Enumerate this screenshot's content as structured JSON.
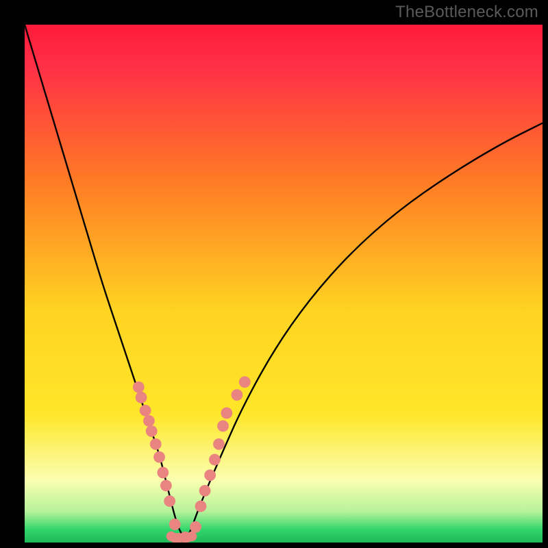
{
  "watermark": "TheBottleneck.com",
  "colors": {
    "background_frame": "#000000",
    "curve_stroke": "#000000",
    "marker_fill": "#e98481",
    "gradient_top": "#ff1a3a",
    "gradient_mid_upper": "#ff8a1a",
    "gradient_mid": "#ffe628",
    "gradient_band": "#f9ffb2",
    "gradient_green": "#31d66b"
  },
  "chart_data": {
    "type": "line",
    "title": "",
    "xlabel": "",
    "ylabel": "",
    "xlim": [
      0,
      100
    ],
    "ylim": [
      0,
      100
    ],
    "grid": false,
    "legend": false,
    "series": [
      {
        "name": "bottleneck-curve",
        "x": [
          0,
          3,
          6,
          9,
          12,
          15,
          18,
          20,
          22,
          24,
          26,
          27,
          28,
          29,
          30,
          31,
          32,
          33,
          35,
          38,
          42,
          48,
          55,
          63,
          72,
          82,
          92,
          100
        ],
        "y": [
          100,
          90,
          80,
          70,
          60,
          50,
          41,
          35,
          29,
          23,
          17,
          13,
          9,
          5,
          2,
          1,
          2,
          5,
          10,
          17,
          26,
          37,
          47,
          56,
          64,
          71,
          77,
          81
        ]
      }
    ],
    "markers": [
      {
        "name": "left-branch-dots",
        "x": [
          22.0,
          22.5,
          23.3,
          24.0,
          24.5,
          25.3,
          26.0,
          26.7,
          27.3,
          28.0,
          29.0,
          31.0
        ],
        "y": [
          30.0,
          28.0,
          25.5,
          23.5,
          21.5,
          19.0,
          16.5,
          13.5,
          11.0,
          8.0,
          3.5,
          1.0
        ]
      },
      {
        "name": "right-branch-dots",
        "x": [
          33.0,
          34.0,
          34.8,
          35.8,
          36.7,
          37.5,
          38.3,
          39.0,
          41.0,
          42.5
        ],
        "y": [
          3.0,
          7.0,
          10.0,
          13.0,
          16.0,
          19.0,
          22.5,
          25.0,
          28.5,
          31.0
        ]
      },
      {
        "name": "base-strand",
        "x": [
          28.3,
          29.0,
          29.8,
          30.8,
          31.5,
          32.3
        ],
        "y": [
          1.2,
          0.9,
          0.9,
          0.9,
          1.0,
          1.2
        ]
      }
    ],
    "gradient_stops": [
      {
        "offset": 0.0,
        "color": "#ff1a3a"
      },
      {
        "offset": 0.08,
        "color": "#ff2f47"
      },
      {
        "offset": 0.3,
        "color": "#ff7a25"
      },
      {
        "offset": 0.55,
        "color": "#ffd322"
      },
      {
        "offset": 0.75,
        "color": "#ffe628"
      },
      {
        "offset": 0.88,
        "color": "#faffb0"
      },
      {
        "offset": 0.94,
        "color": "#b7f29a"
      },
      {
        "offset": 0.975,
        "color": "#31d66b"
      },
      {
        "offset": 1.0,
        "color": "#1fb95a"
      }
    ]
  }
}
